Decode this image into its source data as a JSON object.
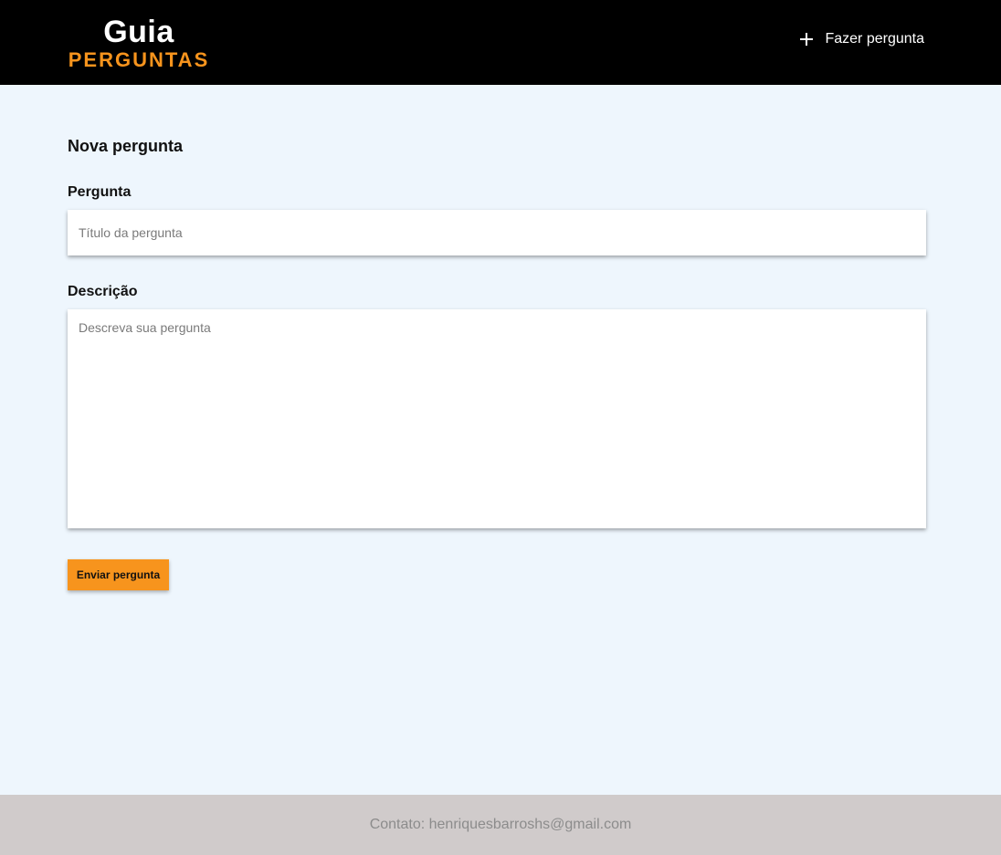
{
  "header": {
    "logo_top": "Guia",
    "logo_bottom": "PERGUNTAS",
    "nav_ask_label": "Fazer pergunta",
    "nav_ask_icon": "plus-icon"
  },
  "form": {
    "title": "Nova pergunta",
    "question_label": "Pergunta",
    "question_value": "",
    "question_placeholder": "Título da pergunta",
    "description_label": "Descrição",
    "description_value": "",
    "description_placeholder": "Descreva sua pergunta",
    "submit_label": "Enviar pergunta"
  },
  "footer": {
    "contact": "Contato: henriquesbarroshs@gmail.com"
  },
  "colors": {
    "header_bg": "#000000",
    "accent": "#f7941d",
    "page_bg": "#eef6fd",
    "footer_bg": "#d0cbcb",
    "footer_text": "#8c8c8c"
  }
}
